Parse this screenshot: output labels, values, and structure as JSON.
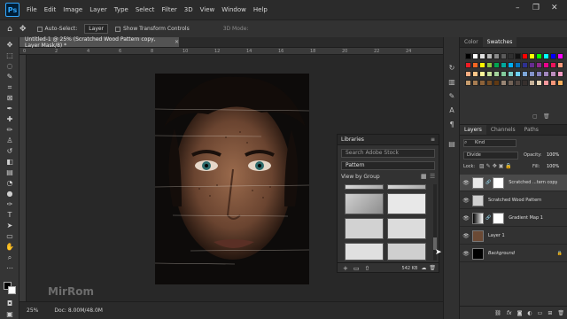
{
  "menubar": {
    "app_logo": "Ps",
    "items": [
      "File",
      "Edit",
      "Image",
      "Layer",
      "Type",
      "Select",
      "Filter",
      "3D",
      "View",
      "Window",
      "Help"
    ],
    "window_controls": [
      "–",
      "❐",
      "✕"
    ]
  },
  "options": {
    "auto_select": "Auto-Select:",
    "target": "Layer",
    "transform": "Show Transform Controls",
    "mode_3d": "3D Mode:"
  },
  "document": {
    "tab_title": "Untitled-1 @ 25% (Scratched Wood Pattern copy, Layer Mask/8) *",
    "ruler_ticks": [
      "0",
      "2",
      "4",
      "6",
      "8",
      "10",
      "12",
      "14",
      "16",
      "18",
      "20",
      "22",
      "24"
    ],
    "watermark": "MirRom"
  },
  "status": {
    "zoom": "25%",
    "doc": "Doc: 8.00M/48.0M"
  },
  "libraries": {
    "title": "Libraries",
    "search_placeholder": "Search Adobe Stock",
    "library_name": "Pattern",
    "view_by": "View by Group",
    "size": "542 KB"
  },
  "swatches": {
    "tabs": [
      "Color",
      "Swatches"
    ],
    "colors": [
      [
        "#000000",
        "#ffffff",
        "#e1e1e1",
        "#b8b8b8",
        "#8a8a8a",
        "#5b5b5b",
        "#303030",
        "#111111",
        "#ff0000",
        "#ffff00",
        "#00ff00",
        "#00ffff",
        "#0000ff",
        "#ff00ff"
      ],
      [
        "#ed1c24",
        "#f26522",
        "#fff200",
        "#8dc63f",
        "#00a651",
        "#00a99d",
        "#00aeef",
        "#0072bc",
        "#2e3192",
        "#662d91",
        "#92278f",
        "#ec008c",
        "#ed145b",
        "#f7977a"
      ],
      [
        "#f9ad81",
        "#fdc689",
        "#fff79a",
        "#c4df9b",
        "#a3d39c",
        "#82ca9c",
        "#7accc8",
        "#6dcff6",
        "#7da7d9",
        "#8393ca",
        "#8781bd",
        "#a187be",
        "#bc8dbf",
        "#f49ac2"
      ],
      [
        "#c69c6d",
        "#a67c52",
        "#8c6239",
        "#754c24",
        "#603913",
        "#998675",
        "#736357",
        "#534741",
        "#362f2d",
        "#c7b299",
        "#e6d3b3",
        "#f5989d",
        "#f69679",
        "#fbaf5d"
      ]
    ]
  },
  "layers": {
    "tabs": [
      "Layers",
      "Channels",
      "Paths"
    ],
    "kind": "Kind",
    "blend": "Divide",
    "opacity_label": "Opacity:",
    "opacity": "100%",
    "lock_label": "Lock:",
    "fill_label": "Fill:",
    "fill": "100%",
    "items": [
      {
        "name": "Scratched ...tern copy",
        "thumb": "#e9e9e9",
        "mask": "#ffffff"
      },
      {
        "name": "Scratched Wood Pattern",
        "thumb": "#cfcfcf",
        "mask": ""
      },
      {
        "name": "Gradient Map 1",
        "thumb": "#8a8a8a",
        "mask": "#ffffff"
      },
      {
        "name": "Layer 1",
        "thumb": "#6b4a35",
        "mask": ""
      },
      {
        "name": "Background",
        "thumb": "#000000",
        "mask": ""
      }
    ],
    "footer_icons": [
      "link-icon",
      "fx-icon",
      "mask-icon",
      "adjustment-icon",
      "folder-icon",
      "new-layer-icon",
      "trash-icon"
    ]
  }
}
